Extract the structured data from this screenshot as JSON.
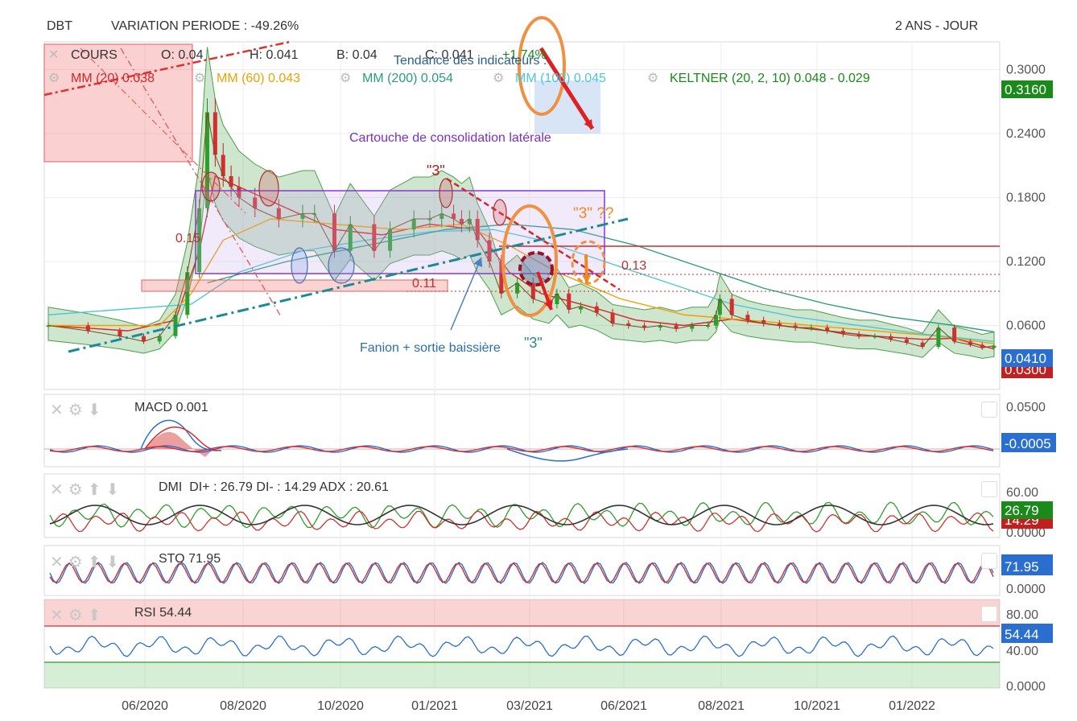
{
  "header": {
    "symbol": "DBT",
    "variation_label": "VARIATION PERIODE : -49.26%",
    "period": "2 ANS - JOUR"
  },
  "legend": {
    "cours": "COURS",
    "open": "O: 0.04",
    "high": "H: 0.041",
    "low": "B: 0.04",
    "close": "C: 0.041",
    "change": "+1.74%",
    "mm20": "MM (20) 0.038",
    "mm60": "MM (60) 0.043",
    "mm200": "MM (200) 0.054",
    "mm100": "MM (100) 0.045",
    "keltner": "KELTNER (20, 2, 10) 0.048 - 0.029",
    "colors": {
      "mm20": "#d62728",
      "mm60": "#f0a000",
      "mm200": "#2a9d7a",
      "mm100": "#4ac8d8",
      "keltner": "#1a8a1a"
    }
  },
  "annotations": {
    "tendance": "Tendance des indicateurs :",
    "cartouche": "Cartouche de consolidation latérale",
    "fanion": "Fanion + sortie baissière",
    "three_a": "\"3\"",
    "three_b": "\"3\" ??",
    "three_c": "\"3\"",
    "lvl_013": "0.13",
    "lvl_011": "0.11",
    "lvl_015": "0.15"
  },
  "price_panel": {
    "ticks": [
      "0.3000",
      "0.2400",
      "0.1800",
      "0.1200",
      "0.0600"
    ],
    "badge_top": "0.3160",
    "badge_last": "0.0410",
    "badge_low": "0.0300"
  },
  "macd": {
    "title": "MACD",
    "value": "0.001",
    "ticks": [
      "0.0500"
    ],
    "badge": "-0.0005"
  },
  "dmi": {
    "title": "DMI",
    "value": "DI+ : 26.79 DI- : 14.29 ADX : 20.61",
    "ticks": [
      "60.00",
      "0.0000"
    ],
    "badge": "26.79",
    "badge2": "14.29"
  },
  "sto": {
    "title": "STO",
    "value": "71.95",
    "ticks": [
      "0.0000"
    ],
    "badge": "71.95"
  },
  "rsi": {
    "title": "RSI",
    "value": "54.44",
    "ticks": [
      "80.00",
      "40.00",
      "0.0000"
    ],
    "badge": "54.44"
  },
  "chart_data": {
    "type": "line",
    "title": "",
    "x_tick_labels": [
      "06/2020",
      "08/2020",
      "10/2020",
      "01/2021",
      "03/2021",
      "06/2021",
      "08/2021",
      "10/2021",
      "01/2022"
    ],
    "ylim": [
      0,
      0.32
    ],
    "series": [
      {
        "name": "COURS",
        "x": [
          0,
          5,
          9,
          12,
          14,
          16,
          17.5,
          19,
          20,
          21,
          22,
          23,
          24,
          26,
          29,
          32,
          33.5,
          36,
          38,
          41,
          43,
          46,
          48,
          49.5,
          51,
          52,
          53,
          54,
          55.5,
          57,
          59,
          61,
          63,
          64,
          65.5,
          67,
          69,
          71,
          73,
          75,
          77,
          79,
          81,
          83,
          84,
          84.5,
          86,
          88,
          90,
          92,
          94,
          96,
          98,
          100,
          102,
          104,
          106,
          108,
          110,
          112,
          114,
          116,
          117.5,
          119
        ],
        "y": [
          0.06,
          0.055,
          0.05,
          0.045,
          0.05,
          0.07,
          0.11,
          0.17,
          0.26,
          0.22,
          0.2,
          0.19,
          0.18,
          0.17,
          0.16,
          0.165,
          0.165,
          0.13,
          0.155,
          0.13,
          0.15,
          0.16,
          0.16,
          0.165,
          0.16,
          0.155,
          0.16,
          0.14,
          0.12,
          0.09,
          0.1,
          0.085,
          0.08,
          0.09,
          0.075,
          0.078,
          0.072,
          0.062,
          0.06,
          0.058,
          0.06,
          0.057,
          0.06,
          0.06,
          0.07,
          0.085,
          0.07,
          0.065,
          0.062,
          0.06,
          0.058,
          0.058,
          0.055,
          0.052,
          0.05,
          0.05,
          0.047,
          0.044,
          0.04,
          0.058,
          0.045,
          0.042,
          0.039,
          0.041
        ]
      },
      {
        "name": "MM (20)",
        "x": [
          0,
          10,
          16,
          19,
          21,
          24,
          30,
          36,
          42,
          48,
          54,
          58,
          62,
          68,
          74,
          80,
          86,
          92,
          98,
          104,
          110,
          114,
          119
        ],
        "y": [
          0.06,
          0.055,
          0.065,
          0.13,
          0.2,
          0.19,
          0.17,
          0.15,
          0.145,
          0.155,
          0.15,
          0.11,
          0.09,
          0.078,
          0.065,
          0.06,
          0.066,
          0.06,
          0.055,
          0.05,
          0.047,
          0.048,
          0.038
        ]
      },
      {
        "name": "MM (60)",
        "x": [
          0,
          14,
          18,
          22,
          28,
          36,
          44,
          52,
          58,
          64,
          72,
          80,
          88,
          96,
          104,
          112,
          119
        ],
        "y": [
          0.06,
          0.06,
          0.09,
          0.14,
          0.16,
          0.155,
          0.15,
          0.155,
          0.135,
          0.11,
          0.085,
          0.07,
          0.065,
          0.06,
          0.055,
          0.05,
          0.043
        ]
      },
      {
        "name": "MM (100)",
        "x": [
          0,
          18,
          24,
          32,
          40,
          48,
          56,
          62,
          70,
          78,
          86,
          94,
          102,
          110,
          119
        ],
        "y": [
          0.07,
          0.08,
          0.11,
          0.13,
          0.14,
          0.148,
          0.15,
          0.14,
          0.12,
          0.1,
          0.08,
          0.068,
          0.06,
          0.052,
          0.045
        ]
      },
      {
        "name": "MM (200)",
        "x": [
          20,
          30,
          40,
          50,
          58,
          66,
          74,
          82,
          90,
          98,
          106,
          114,
          119
        ],
        "y": [
          0.1,
          0.12,
          0.135,
          0.15,
          0.155,
          0.15,
          0.135,
          0.115,
          0.095,
          0.08,
          0.068,
          0.06,
          0.054
        ]
      }
    ]
  }
}
